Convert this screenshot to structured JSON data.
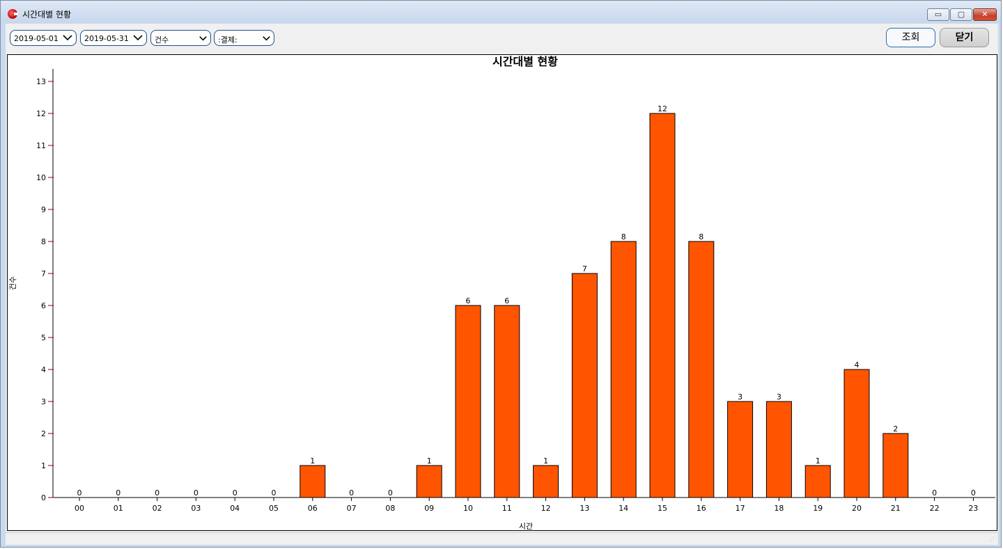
{
  "window": {
    "title": "시간대별 현황",
    "app_icon": "app-logo-icon",
    "buttons": {
      "minimize": "▭",
      "maximize": "▢",
      "close": "✕"
    }
  },
  "toolbar": {
    "date_from": "2019-05-01",
    "date_to": "2019-05-31",
    "metric": "건수",
    "payment": ":결제:",
    "query_label": "조회",
    "close_label": "닫기"
  },
  "colors": {
    "bar": "#ff5500",
    "accent": "#1f4f8f",
    "tick": "#8b0000"
  },
  "chart_data": {
    "type": "bar",
    "title": "시간대별 현황",
    "xlabel": "시간",
    "ylabel": "건수",
    "ylim": [
      0,
      13
    ],
    "yticks": [
      "0",
      "1",
      "2",
      "3",
      "4",
      "5",
      "6",
      "7",
      "8",
      "9",
      "10",
      "11",
      "12",
      "13"
    ],
    "categories": [
      "00",
      "01",
      "02",
      "03",
      "04",
      "05",
      "06",
      "07",
      "08",
      "09",
      "10",
      "11",
      "12",
      "13",
      "14",
      "15",
      "16",
      "17",
      "18",
      "19",
      "20",
      "21",
      "22",
      "23"
    ],
    "values": [
      0,
      0,
      0,
      0,
      0,
      0,
      1,
      0,
      0,
      1,
      6,
      6,
      1,
      7,
      8,
      12,
      8,
      3,
      3,
      1,
      4,
      2,
      0,
      0
    ],
    "value_labels": [
      "0",
      "0",
      "0",
      "0",
      "0",
      "0",
      "1",
      "0",
      "0",
      "1",
      "6",
      "6",
      "1",
      "7",
      "8",
      "12",
      "8",
      "3",
      "3",
      "1",
      "4",
      "2",
      "0",
      "0"
    ],
    "grid": false,
    "legend": "none"
  }
}
